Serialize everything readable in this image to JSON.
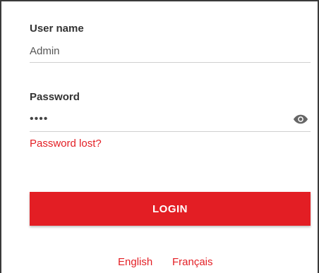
{
  "form": {
    "username": {
      "label": "User name",
      "value": "Admin"
    },
    "password": {
      "label": "Password",
      "value": "••••",
      "toggle_icon": "eye-icon"
    },
    "password_lost_link": "Password lost?",
    "login_button": "LOGIN"
  },
  "languages": [
    "English",
    "Français"
  ],
  "colors": {
    "accent": "#e31e24",
    "label": "#333333",
    "underline": "#cfcfcf"
  }
}
